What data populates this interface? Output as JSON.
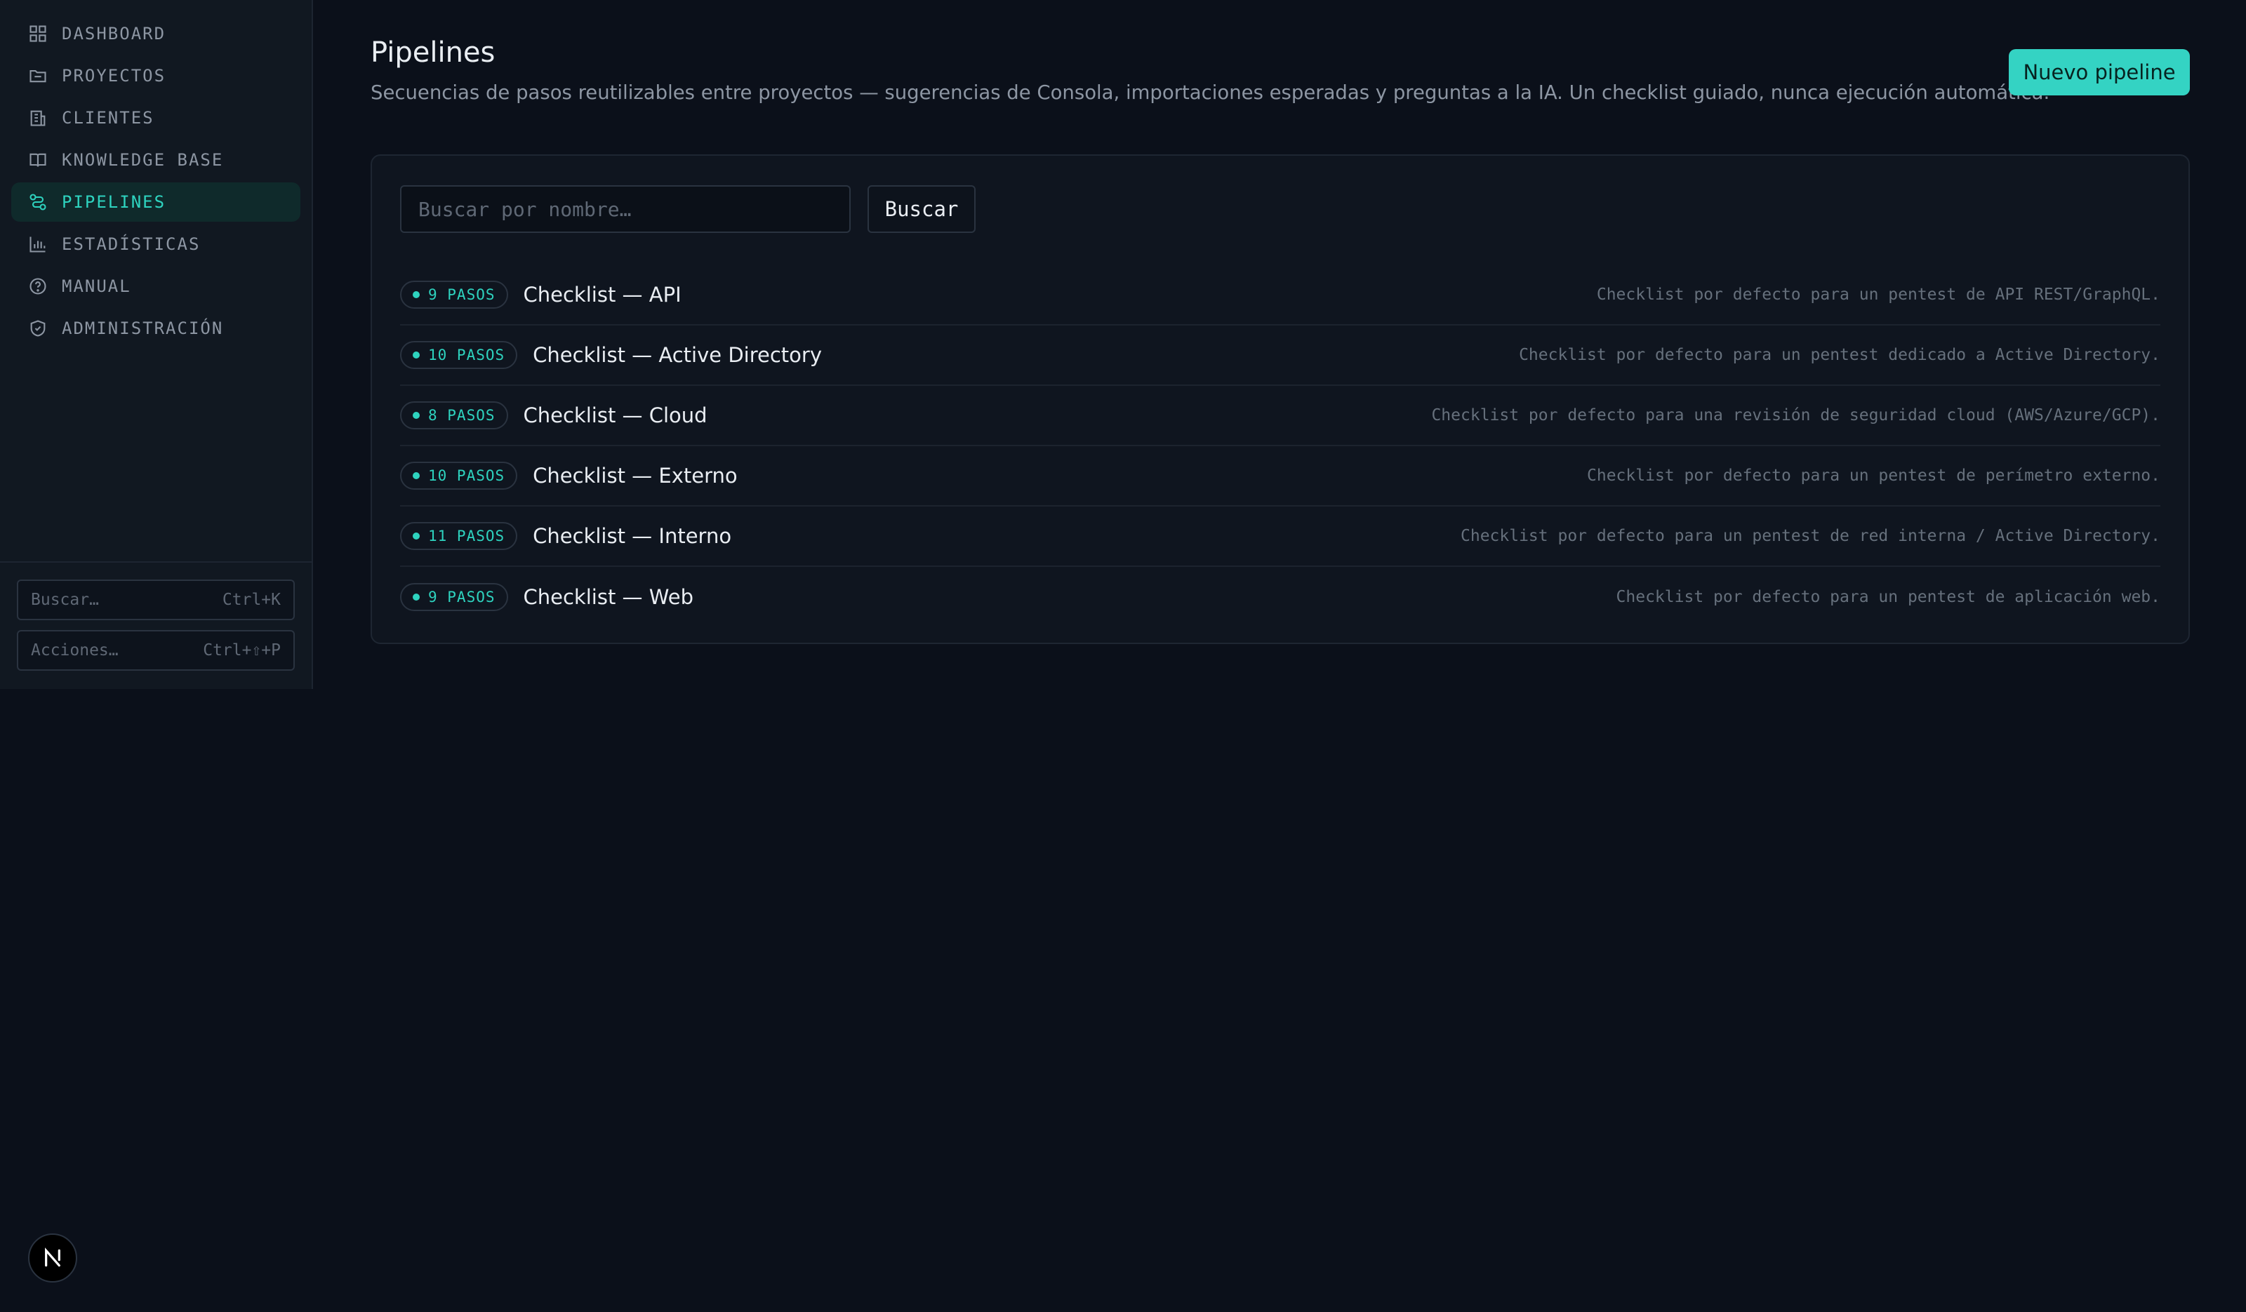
{
  "sidebar": {
    "items": [
      {
        "label": "DASHBOARD",
        "icon": "dashboard-icon"
      },
      {
        "label": "PROYECTOS",
        "icon": "folder-icon"
      },
      {
        "label": "CLIENTES",
        "icon": "building-icon"
      },
      {
        "label": "KNOWLEDGE BASE",
        "icon": "book-icon"
      },
      {
        "label": "PIPELINES",
        "icon": "route-icon",
        "active": true
      },
      {
        "label": "ESTADÍSTICAS",
        "icon": "bar-chart-icon"
      },
      {
        "label": "MANUAL",
        "icon": "help-circle-icon"
      },
      {
        "label": "ADMINISTRACIÓN",
        "icon": "shield-icon"
      }
    ],
    "quick_search": {
      "label": "Buscar…",
      "shortcut": "Ctrl+K"
    },
    "quick_actions": {
      "label": "Acciones…",
      "shortcut": "Ctrl+⇧+P"
    }
  },
  "header": {
    "title": "Pipelines",
    "subtitle": "Secuencias de pasos reutilizables entre proyectos — sugerencias de Consola, importaciones esperadas y preguntas a la IA. Un checklist guiado, nunca ejecución automática.",
    "new_button": "Nuevo pipeline"
  },
  "search": {
    "placeholder": "Buscar por nombre…",
    "button": "Buscar"
  },
  "pipelines": [
    {
      "steps": "9 PASOS",
      "name": "Checklist — API",
      "description": "Checklist por defecto para un pentest de API REST/GraphQL."
    },
    {
      "steps": "10 PASOS",
      "name": "Checklist — Active Directory",
      "description": "Checklist por defecto para un pentest dedicado a Active Directory."
    },
    {
      "steps": "8 PASOS",
      "name": "Checklist — Cloud",
      "description": "Checklist por defecto para una revisión de seguridad cloud (AWS/Azure/GCP)."
    },
    {
      "steps": "10 PASOS",
      "name": "Checklist — Externo",
      "description": "Checklist por defecto para un pentest de perímetro externo."
    },
    {
      "steps": "11 PASOS",
      "name": "Checklist — Interno",
      "description": "Checklist por defecto para un pentest de red interna / Active Directory."
    },
    {
      "steps": "9 PASOS",
      "name": "Checklist — Web",
      "description": "Checklist por defecto para un pentest de aplicación web."
    }
  ],
  "colors": {
    "accent": "#34d3c3",
    "background": "#0b101a",
    "sidebar": "#111821"
  }
}
